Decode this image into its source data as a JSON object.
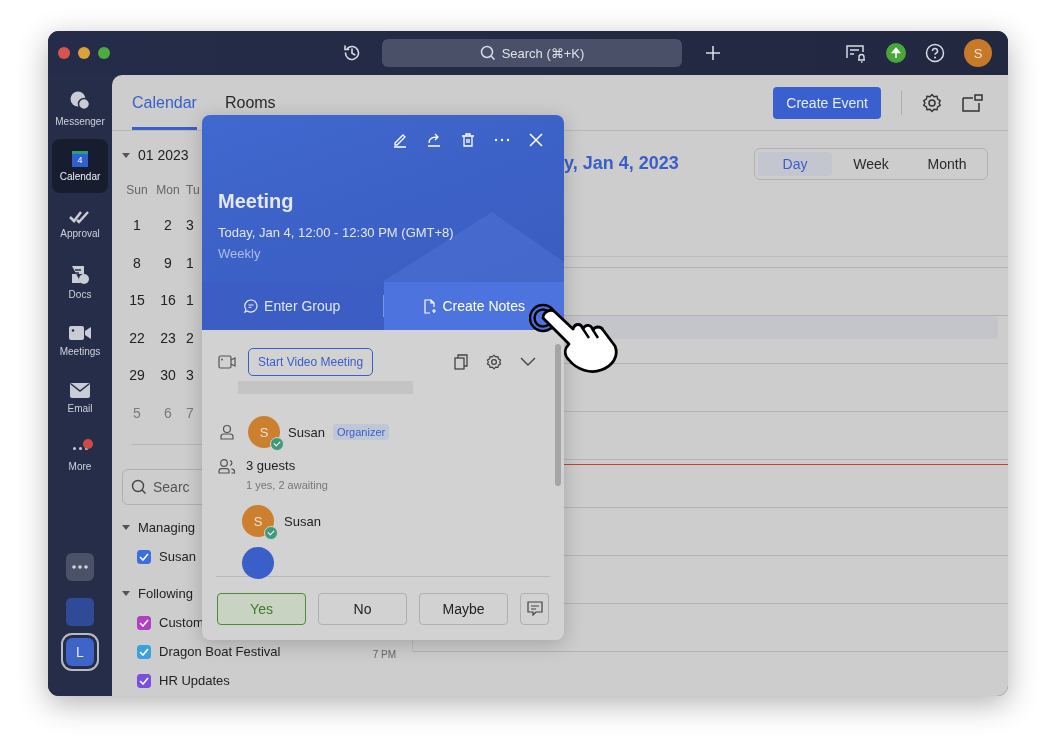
{
  "titlebar": {
    "search": {
      "placeholder": "Search (⌘+K)"
    },
    "avatar": "S"
  },
  "rail": {
    "items": [
      {
        "label": "Messenger",
        "kind": "messenger",
        "selected": false,
        "badge": false
      },
      {
        "label": "Calendar",
        "kind": "calendar",
        "selected": true,
        "badge": false,
        "icon_text": "4"
      },
      {
        "label": "Approval",
        "kind": "approval",
        "selected": false,
        "badge": false
      },
      {
        "label": "Docs",
        "kind": "docs",
        "selected": false,
        "badge": false
      },
      {
        "label": "Meetings",
        "kind": "meetings",
        "selected": false,
        "badge": false
      },
      {
        "label": "Email",
        "kind": "email",
        "selected": false,
        "badge": false
      },
      {
        "label": "More",
        "kind": "more",
        "selected": false,
        "badge": true
      }
    ],
    "user_avatar": "L"
  },
  "header": {
    "tabs": [
      {
        "label": "Calendar",
        "selected": true
      },
      {
        "label": "Rooms",
        "selected": false
      }
    ],
    "create_button": "Create Event"
  },
  "mini_calendar": {
    "month": "01 2023",
    "weekdays": [
      "Sun",
      "Mon",
      "Tu"
    ],
    "weeks": [
      [
        {
          "day": "1",
          "outside": false
        },
        {
          "day": "2",
          "outside": false
        },
        {
          "day": "3",
          "outside": false
        }
      ],
      [
        {
          "day": "8",
          "outside": false
        },
        {
          "day": "9",
          "outside": false
        },
        {
          "day": "1",
          "outside": false
        }
      ],
      [
        {
          "day": "15",
          "outside": false
        },
        {
          "day": "16",
          "outside": false
        },
        {
          "day": "1",
          "outside": false
        }
      ],
      [
        {
          "day": "22",
          "outside": false
        },
        {
          "day": "23",
          "outside": false
        },
        {
          "day": "2",
          "outside": false
        }
      ],
      [
        {
          "day": "29",
          "outside": false
        },
        {
          "day": "30",
          "outside": false
        },
        {
          "day": "3",
          "outside": false
        }
      ],
      [
        {
          "day": "5",
          "outside": true
        },
        {
          "day": "6",
          "outside": true
        },
        {
          "day": "7",
          "outside": true
        }
      ]
    ]
  },
  "calendar_search": {
    "placeholder": "Searc"
  },
  "calendar_groups": [
    {
      "title": "Managing",
      "expanded": true,
      "calendars": [
        {
          "name": "Susan",
          "checked": true,
          "color": "#3d6ee0"
        }
      ]
    },
    {
      "title": "Following",
      "expanded": true,
      "calendars": [
        {
          "name": "Custom",
          "checked": true,
          "color": "#b23fc0"
        },
        {
          "name": "Dragon Boat Festival",
          "checked": true,
          "color": "#3ba0de"
        },
        {
          "name": "HR Updates",
          "checked": true,
          "color": "#7a4ee0"
        }
      ]
    }
  ],
  "day_view": {
    "date": "y, Jan 4, 2023",
    "views": [
      {
        "label": "Day",
        "selected": true
      },
      {
        "label": "Week",
        "selected": false
      },
      {
        "label": "Month",
        "selected": false
      }
    ],
    "time_label": "7 PM"
  },
  "event_popup": {
    "title": "Meeting",
    "time": "Today, Jan 4, 12:00 - 12:30 PM (GMT+8)",
    "recurrence": "Weekly",
    "actions": [
      {
        "label": "Enter Group",
        "kind": "group",
        "hovered": false
      },
      {
        "label": "Create Notes",
        "kind": "notes",
        "hovered": true
      }
    ],
    "video_button": "Start Video Meeting",
    "organizer": {
      "avatar": "S",
      "name": "Susan",
      "badge": "Organizer",
      "accepted": true
    },
    "guests": {
      "count": "3 guests",
      "summary": "1 yes, 2 awaiting",
      "list": [
        {
          "avatar": "S",
          "name": "Susan",
          "accepted": true
        }
      ]
    },
    "rsvp": [
      {
        "label": "Yes",
        "selected": true
      },
      {
        "label": "No",
        "selected": false
      },
      {
        "label": "Maybe",
        "selected": false
      }
    ]
  }
}
